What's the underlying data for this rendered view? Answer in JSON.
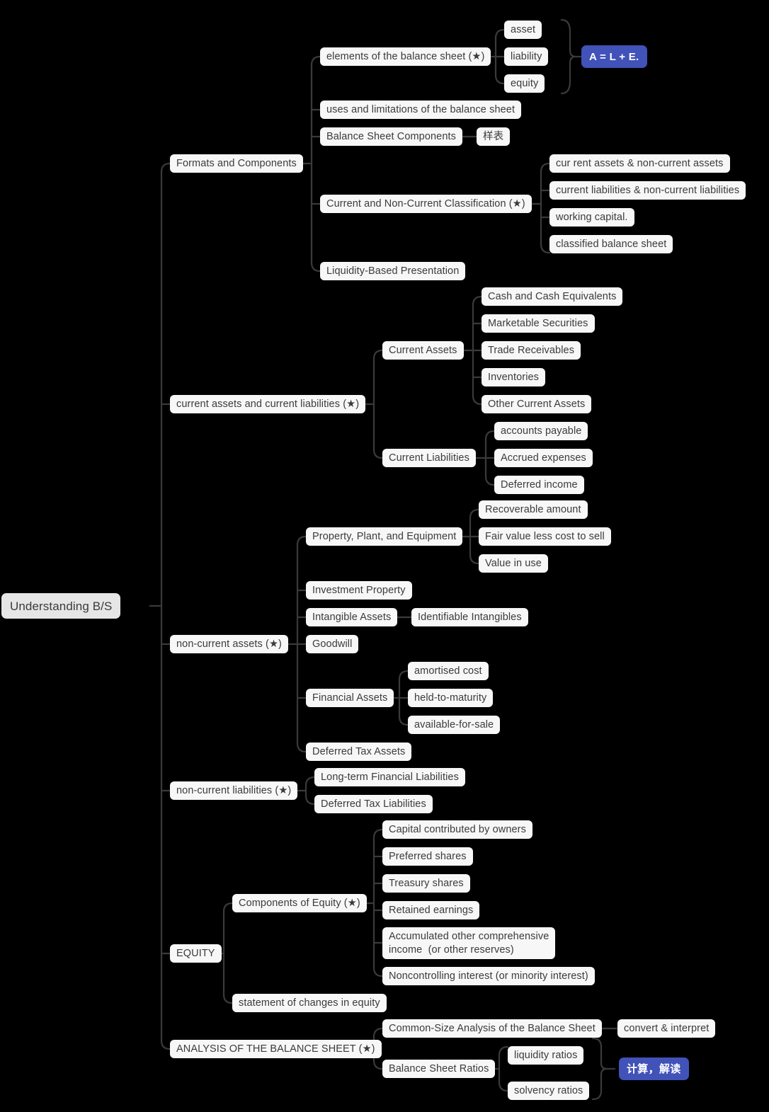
{
  "diagram": {
    "title": "Understanding B/S",
    "type": "mindmap",
    "background_color": "#000000",
    "node_color": "#f7f7f7",
    "root_node_color": "#e6e6e6",
    "accent_color": "#4152b8",
    "text_color": "#3b3b3b",
    "link_color": "#3a3a3a"
  },
  "nodes": {
    "root": "Understanding B/S",
    "b1": "Formats and Components",
    "b1_1": "elements of the balance sheet (★)",
    "b1_1_1": "asset",
    "b1_1_2": "liability",
    "b1_1_3": "equity",
    "b1_1_note": "A = L + E.",
    "b1_2": "uses and limitations of the balance sheet",
    "b1_3": "Balance Sheet Components",
    "b1_3_1": "样表",
    "b1_4": "Current and Non-Current Classification (★)",
    "b1_4_1": "cur rent assets & non-current assets",
    "b1_4_2": "current liabilities & non-current liabilities",
    "b1_4_3": "working capital.",
    "b1_4_4": "classified balance sheet",
    "b1_5": "Liquidity-Based Presentation",
    "b2": "current assets and current liabilities (★)",
    "b2_1": "Current Assets",
    "b2_1_1": "Cash and Cash Equivalents",
    "b2_1_2": "Marketable Securities",
    "b2_1_3": "Trade Receivables",
    "b2_1_4": "Inventories",
    "b2_1_5": "Other Current Assets",
    "b2_2": "Current Liabilities",
    "b2_2_1": "accounts payable",
    "b2_2_2": "Accrued expenses",
    "b2_2_3": "Deferred income",
    "b3": "non-current assets (★)",
    "b3_1": "Property, Plant, and Equipment",
    "b3_1_1": "Recoverable amount",
    "b3_1_2": "Fair value less cost to sell",
    "b3_1_3": "Value in use",
    "b3_2": "Investment Property",
    "b3_3": "Intangible Assets",
    "b3_3_1": "Identifiable Intangibles",
    "b3_4": "Goodwill",
    "b3_5": "Financial Assets",
    "b3_5_1": "amortised cost",
    "b3_5_2": "held-to-maturity",
    "b3_5_3": "available-for-sale",
    "b3_6": "Deferred Tax Assets",
    "b4": "non-current liabilities (★)",
    "b4_1": "Long-term Financial Liabilities",
    "b4_2": "Deferred Tax Liabilities",
    "b5": "EQUITY",
    "b5_1": "Components of Equity (★)",
    "b5_1_1": "Capital contributed by owners",
    "b5_1_2": "Preferred shares",
    "b5_1_3": "Treasury shares",
    "b5_1_4": "Retained earnings",
    "b5_1_5": "Accumulated other comprehensive\nincome  (or other reserves)",
    "b5_1_6": "Noncontrolling interest (or minority interest)",
    "b5_2": "statement of changes in equity",
    "b6": "ANALYSIS OF THE BALANCE SHEET (★)",
    "b6_1": "Common-Size Analysis of the Balance Sheet",
    "b6_1_1": "convert & interpret",
    "b6_2": "Balance Sheet Ratios",
    "b6_2_1": "liquidity ratios",
    "b6_2_2": "solvency ratios",
    "b6_2_note": "计算，解读"
  }
}
